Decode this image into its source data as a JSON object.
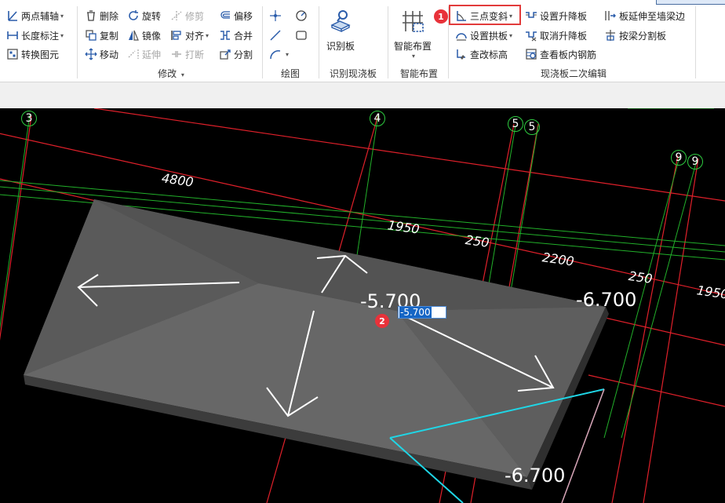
{
  "ribbon": {
    "groups": {
      "axis": {
        "items": [
          {
            "label": "两点辅轴",
            "icon": "two-point-axis-icon",
            "caret": "▾"
          },
          {
            "label": "长度标注",
            "icon": "length-dimension-icon",
            "caret": "▾"
          },
          {
            "label": "转换图元",
            "icon": "convert-element-icon"
          }
        ]
      },
      "modify": {
        "title": "修改",
        "caret": "▾",
        "items": [
          {
            "label": "删除",
            "icon": "delete-icon"
          },
          {
            "label": "旋转",
            "icon": "rotate-icon"
          },
          {
            "label": "修剪",
            "icon": "trim-icon"
          },
          {
            "label": "偏移",
            "icon": "offset-icon"
          },
          {
            "label": "复制",
            "icon": "copy-icon"
          },
          {
            "label": "镜像",
            "icon": "mirror-icon"
          },
          {
            "label": "对齐",
            "icon": "align-icon",
            "caret": "▾"
          },
          {
            "label": "合并",
            "icon": "merge-icon"
          },
          {
            "label": "移动",
            "icon": "move-icon"
          },
          {
            "label": "延伸",
            "icon": "extend-icon"
          },
          {
            "label": "打断",
            "icon": "break-icon"
          },
          {
            "label": "分割",
            "icon": "split-icon"
          }
        ]
      },
      "draw": {
        "title": "绘图"
      },
      "identify": {
        "title": "识别现浇板",
        "button": "识别板"
      },
      "smart": {
        "title": "智能布置",
        "button": "智能布置",
        "caret": "▾"
      },
      "slab_edit": {
        "title": "现浇板二次编辑",
        "items": [
          {
            "label": "三点变斜",
            "icon": "three-point-slope-icon",
            "caret": "▾"
          },
          {
            "label": "设置升降板",
            "icon": "set-drop-slab-icon"
          },
          {
            "label": "板延伸至墙梁边",
            "icon": "extend-slab-icon"
          },
          {
            "label": "设置拱板",
            "icon": "set-arch-slab-icon",
            "caret": "▾"
          },
          {
            "label": "取消升降板",
            "icon": "cancel-drop-slab-icon"
          },
          {
            "label": "按梁分割板",
            "icon": "split-by-beam-icon"
          },
          {
            "label": "查改标高",
            "icon": "edit-elevation-icon"
          },
          {
            "label": "查看板内钢筋",
            "icon": "view-rebar-icon"
          }
        ]
      }
    }
  },
  "badges": [
    "1",
    "2"
  ],
  "canvas": {
    "axis_numbers": [
      "3",
      "4",
      "5",
      "5",
      "9",
      "9"
    ],
    "dimensions": [
      "4800",
      "1950",
      "250",
      "2200",
      "250",
      "1950"
    ],
    "elevations": [
      "-5.700",
      "-6.700",
      "-6.700"
    ],
    "edit_value": "-5.700"
  },
  "colors": {
    "highlight": "#e23b3b",
    "grid_red": "#e0202a",
    "grid_green": "#22b02a",
    "slab": "#5b5b5b",
    "cyan": "#1fd6e6"
  }
}
